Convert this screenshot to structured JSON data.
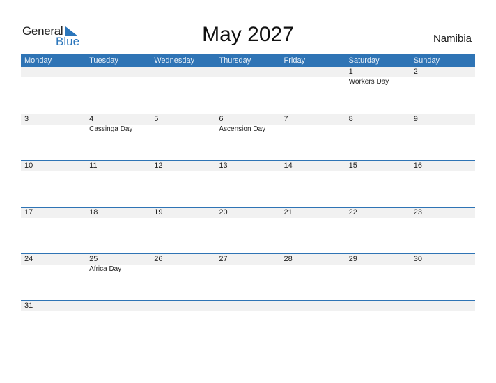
{
  "logo": {
    "general": "General",
    "blue": "Blue"
  },
  "title": "May 2027",
  "country": "Namibia",
  "weekdays": [
    "Monday",
    "Tuesday",
    "Wednesday",
    "Thursday",
    "Friday",
    "Saturday",
    "Sunday"
  ],
  "weeks": [
    {
      "days": [
        "",
        "",
        "",
        "",
        "",
        "1",
        "2"
      ],
      "holidays": [
        "",
        "",
        "",
        "",
        "",
        "Workers Day",
        ""
      ]
    },
    {
      "days": [
        "3",
        "4",
        "5",
        "6",
        "7",
        "8",
        "9"
      ],
      "holidays": [
        "",
        "Cassinga Day",
        "",
        "Ascension Day",
        "",
        "",
        ""
      ]
    },
    {
      "days": [
        "10",
        "11",
        "12",
        "13",
        "14",
        "15",
        "16"
      ],
      "holidays": [
        "",
        "",
        "",
        "",
        "",
        "",
        ""
      ]
    },
    {
      "days": [
        "17",
        "18",
        "19",
        "20",
        "21",
        "22",
        "23"
      ],
      "holidays": [
        "",
        "",
        "",
        "",
        "",
        "",
        ""
      ]
    },
    {
      "days": [
        "24",
        "25",
        "26",
        "27",
        "28",
        "29",
        "30"
      ],
      "holidays": [
        "",
        "Africa Day",
        "",
        "",
        "",
        "",
        ""
      ]
    },
    {
      "days": [
        "31",
        "",
        "",
        "",
        "",
        "",
        ""
      ],
      "holidays": [
        "",
        "",
        "",
        "",
        "",
        "",
        ""
      ]
    }
  ]
}
